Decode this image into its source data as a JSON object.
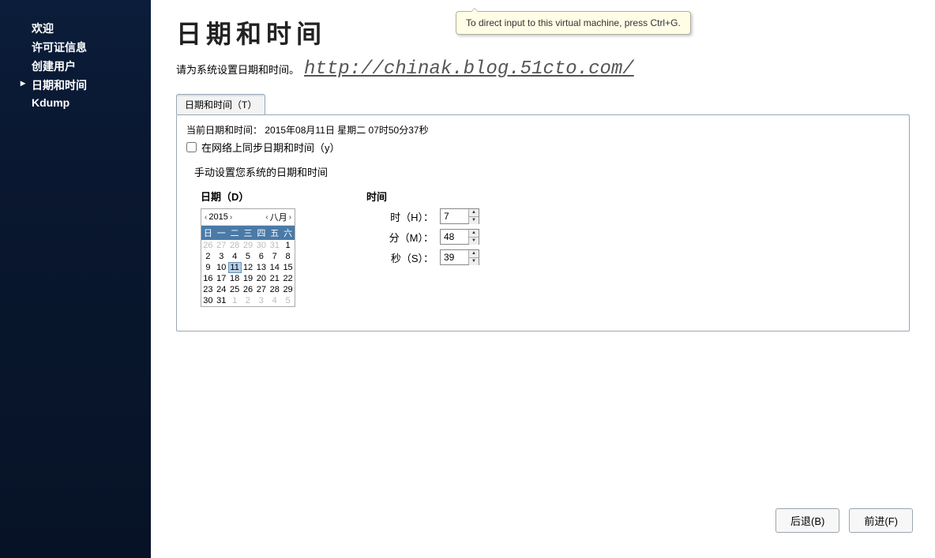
{
  "sidebar": {
    "items": [
      {
        "label": "欢迎"
      },
      {
        "label": "许可证信息"
      },
      {
        "label": "创建用户"
      },
      {
        "label": "日期和时间",
        "active": true
      },
      {
        "label": "Kdump"
      }
    ]
  },
  "header": {
    "title": "日期和时间",
    "subtitle": "请为系统设置日期和时间。",
    "watermark": "http://chinak.blog.51cto.com/"
  },
  "tooltip": "To direct input to this virtual machine, press Ctrl+G.",
  "tabs": [
    {
      "label": "日期和时间（T）"
    }
  ],
  "panel": {
    "current_label": "当前日期和时间：",
    "current_value": "2015年08月11日 星期二 07时50分37秒",
    "sync_label": "在网络上同步日期和时间（y）",
    "sync_checked": false,
    "manual_label": "手动设置您系统的日期和时间",
    "date_section_label": "日期（D）",
    "time_section_label": "时间",
    "calendar": {
      "year": "2015",
      "month": "八月",
      "dow": [
        "日",
        "一",
        "二",
        "三",
        "四",
        "五",
        "六"
      ],
      "cells": [
        {
          "d": "26",
          "o": true
        },
        {
          "d": "27",
          "o": true
        },
        {
          "d": "28",
          "o": true
        },
        {
          "d": "29",
          "o": true
        },
        {
          "d": "30",
          "o": true
        },
        {
          "d": "31",
          "o": true
        },
        {
          "d": "1"
        },
        {
          "d": "2"
        },
        {
          "d": "3"
        },
        {
          "d": "4"
        },
        {
          "d": "5"
        },
        {
          "d": "6"
        },
        {
          "d": "7"
        },
        {
          "d": "8"
        },
        {
          "d": "9"
        },
        {
          "d": "10"
        },
        {
          "d": "11",
          "sel": true
        },
        {
          "d": "12"
        },
        {
          "d": "13"
        },
        {
          "d": "14"
        },
        {
          "d": "15"
        },
        {
          "d": "16"
        },
        {
          "d": "17"
        },
        {
          "d": "18"
        },
        {
          "d": "19"
        },
        {
          "d": "20"
        },
        {
          "d": "21"
        },
        {
          "d": "22"
        },
        {
          "d": "23"
        },
        {
          "d": "24"
        },
        {
          "d": "25"
        },
        {
          "d": "26"
        },
        {
          "d": "27"
        },
        {
          "d": "28"
        },
        {
          "d": "29"
        },
        {
          "d": "30"
        },
        {
          "d": "31"
        },
        {
          "d": "1",
          "o": true
        },
        {
          "d": "2",
          "o": true
        },
        {
          "d": "3",
          "o": true
        },
        {
          "d": "4",
          "o": true
        },
        {
          "d": "5",
          "o": true
        }
      ]
    },
    "time": {
      "hour_label": "时（H）：",
      "hour_value": "7",
      "minute_label": "分（M）：",
      "minute_value": "48",
      "second_label": "秒（S）：",
      "second_value": "39"
    }
  },
  "footer": {
    "back": "后退(B)",
    "forward": "前进(F)"
  }
}
